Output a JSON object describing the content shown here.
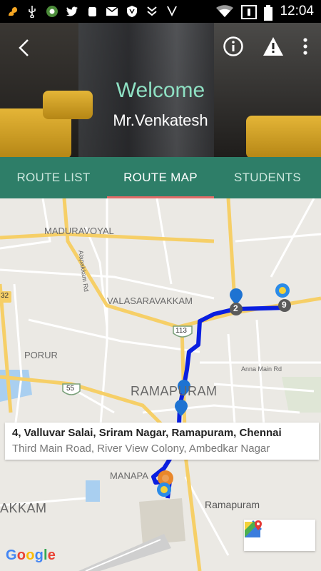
{
  "status_bar": {
    "time": "12:04",
    "icons": [
      "squirrel-icon",
      "usb-icon",
      "chrome-icon",
      "twitter-icon",
      "evernote-icon",
      "gmail-icon",
      "shield-icon",
      "download-icon",
      "tasks-icon",
      "wifi-icon",
      "sim-icon",
      "battery-icon"
    ]
  },
  "header": {
    "welcome": "Welcome",
    "user_name": "Mr.Venkatesh",
    "actions": [
      "back-icon",
      "info-icon",
      "warning-icon",
      "more-vert-icon"
    ]
  },
  "tabs": [
    {
      "label": "ROUTE LIST",
      "active": false
    },
    {
      "label": "ROUTE MAP",
      "active": true
    },
    {
      "label": "STUDENTS",
      "active": false
    }
  ],
  "map": {
    "place_labels": {
      "maduravoyal": "MADURAVOYAL",
      "alapakkam": "Alapakkam Rd",
      "valasaravakkam": "VALASARAVAKKAM",
      "porur": "PORUR",
      "ramapuram_big": "RAMAPURAM",
      "anna_main": "Anna Main Rd",
      "manapakkam": "MANAPA",
      "kkam": "AKKAM",
      "ramapuram_small": "Ramapuram"
    },
    "road_shields": {
      "r32": "32",
      "r113": "113",
      "r55": "55"
    },
    "markers": {
      "stop_2": "2",
      "stop_9": "9"
    },
    "info_window": {
      "title": "4, Valluvar Salai, Sriram Nagar, Ramapuram, Chennai",
      "subtitle": "Third Main Road, River View Colony, Ambedkar Nagar"
    },
    "buttons": [
      "directions-icon",
      "google-maps-icon"
    ],
    "attribution": "Google"
  }
}
